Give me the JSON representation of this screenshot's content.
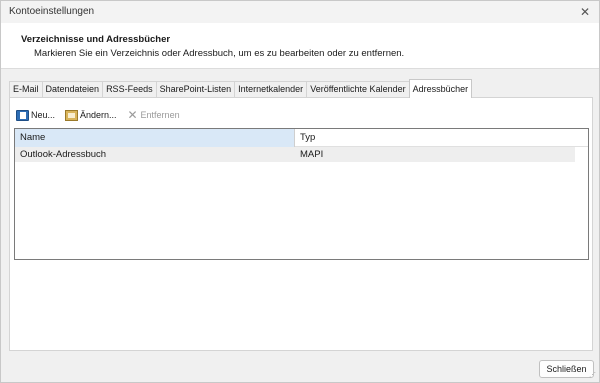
{
  "window": {
    "title": "Kontoeinstellungen"
  },
  "header": {
    "title": "Verzeichnisse und Adressbücher",
    "subtitle": "Markieren Sie ein Verzeichnis oder Adressbuch, um es zu bearbeiten oder zu entfernen."
  },
  "tabs": [
    {
      "label": "E-Mail",
      "active": false
    },
    {
      "label": "Datendateien",
      "active": false
    },
    {
      "label": "RSS-Feeds",
      "active": false
    },
    {
      "label": "SharePoint-Listen",
      "active": false
    },
    {
      "label": "Internetkalender",
      "active": false
    },
    {
      "label": "Veröffentlichte Kalender",
      "active": false
    },
    {
      "label": "Adressbücher",
      "active": true
    }
  ],
  "toolbar": {
    "new_label": "Neu...",
    "change_label": "Ändern...",
    "remove_label": "Entfernen"
  },
  "table": {
    "columns": [
      "Name",
      "Typ"
    ],
    "rows": [
      {
        "name": "Outlook-Adressbuch",
        "type": "MAPI"
      }
    ]
  },
  "footer": {
    "close_label": "Schließen"
  },
  "colors": {
    "header_selected": "#d9e8f7",
    "row_selected": "#eeeeee"
  }
}
